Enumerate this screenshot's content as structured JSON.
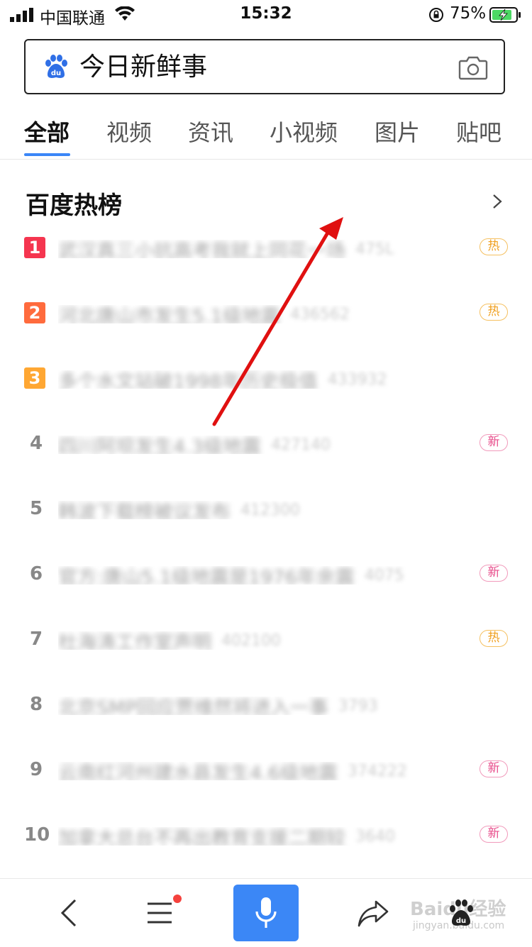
{
  "status_bar": {
    "carrier": "中国联通",
    "time": "15:32",
    "battery_percent": "75%"
  },
  "search": {
    "query": "今日新鲜事"
  },
  "tabs": [
    {
      "label": "全部",
      "active": true
    },
    {
      "label": "视频"
    },
    {
      "label": "资讯"
    },
    {
      "label": "小视频"
    },
    {
      "label": "图片"
    },
    {
      "label": "贴吧"
    }
  ],
  "hot_list": {
    "title": "百度热榜",
    "items": [
      {
        "rank": "1",
        "title": "武汉真三小抗高考我就上同花一场",
        "count": "475L",
        "badge": "热"
      },
      {
        "rank": "2",
        "title": "河北唐山市发生5.1级地震",
        "count": "436562",
        "badge": "热"
      },
      {
        "rank": "3",
        "title": "多个水文站破1998年历史极值",
        "count": "433932",
        "badge": ""
      },
      {
        "rank": "4",
        "title": "四川阿坝发生4.3级地震",
        "count": "427140",
        "badge": "新"
      },
      {
        "rank": "5",
        "title": "韩波下载榜被议发布",
        "count": "412300",
        "badge": ""
      },
      {
        "rank": "6",
        "title": "官方:唐山5.1级地震是1976年余震",
        "count": "4075",
        "badge": "新"
      },
      {
        "rank": "7",
        "title": "杜海涛工作室声明",
        "count": "402100",
        "badge": "热"
      },
      {
        "rank": "8",
        "title": "北京SMP回应贾维然将进入一事",
        "count": "3793",
        "badge": ""
      },
      {
        "rank": "9",
        "title": "云南红河州建水县发生4.6级地震",
        "count": "374222",
        "badge": "新"
      },
      {
        "rank": "10",
        "title": "加拿大总台不再出教育支援二期较",
        "count": "3640",
        "badge": "新"
      }
    ]
  },
  "colors": {
    "accent": "#3a86f7",
    "rank1": "#f5354f",
    "rank2": "#ff6b3d",
    "rank3": "#ffa733",
    "hot_badge": "#f0a020",
    "new_badge": "#e84b8a",
    "annotation_arrow": "#e01010"
  },
  "watermark": {
    "text": "Baidu经验",
    "sub": "jingyan.baidu.com"
  }
}
